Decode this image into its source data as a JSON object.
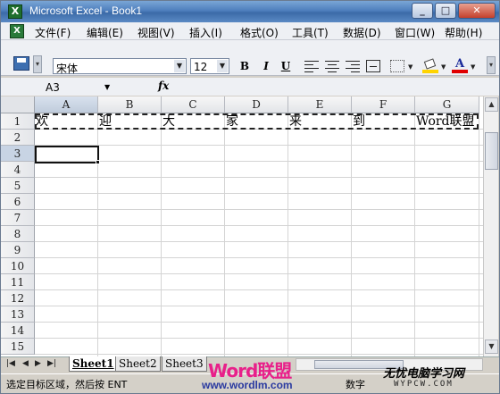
{
  "title_bar": {
    "title": "Microsoft Excel - Book1",
    "minimize": "_",
    "maximize": "□",
    "close": "✕"
  },
  "menu": {
    "items": [
      {
        "label": "文件(F)"
      },
      {
        "label": "编辑(E)"
      },
      {
        "label": "视图(V)"
      },
      {
        "label": "插入(I)"
      },
      {
        "label": "格式(O)"
      },
      {
        "label": "工具(T)"
      },
      {
        "label": "数据(D)"
      },
      {
        "label": "窗口(W)"
      },
      {
        "label": "帮助(H)"
      }
    ],
    "mdi_minimize": "_",
    "mdi_restore": "❐",
    "mdi_close": "×"
  },
  "toolbar": {
    "font_name": "宋体",
    "font_size": "12",
    "bold": "B",
    "italic": "I",
    "underline": "U",
    "font_color_letter": "A",
    "fill_color": "#ffd400",
    "font_color": "#e00000"
  },
  "formula_bar": {
    "name_box": "A3",
    "fx": "fx",
    "content": ""
  },
  "sheet": {
    "columns": [
      "A",
      "B",
      "C",
      "D",
      "E",
      "F",
      "G"
    ],
    "selected_column": "A",
    "rows": [
      "1",
      "2",
      "3",
      "4",
      "5",
      "6",
      "7",
      "8",
      "9",
      "10",
      "11",
      "12",
      "13",
      "14",
      "15"
    ],
    "selected_row": "3",
    "row1_values": [
      "欢",
      "迎",
      "大",
      "家",
      "来",
      "到",
      "Word联盟"
    ],
    "active_cell": "A3"
  },
  "tabs": {
    "sheets": [
      "Sheet1",
      "Sheet2",
      "Sheet3"
    ],
    "active": "Sheet1"
  },
  "status": {
    "message": "选定目标区域，然后按 ENT",
    "mode": "数字"
  },
  "watermarks": {
    "logo": "Word联盟",
    "url": "www.wordlm.com",
    "site": "无忧电脑学习网",
    "site_url": "WYPCW.COM"
  }
}
